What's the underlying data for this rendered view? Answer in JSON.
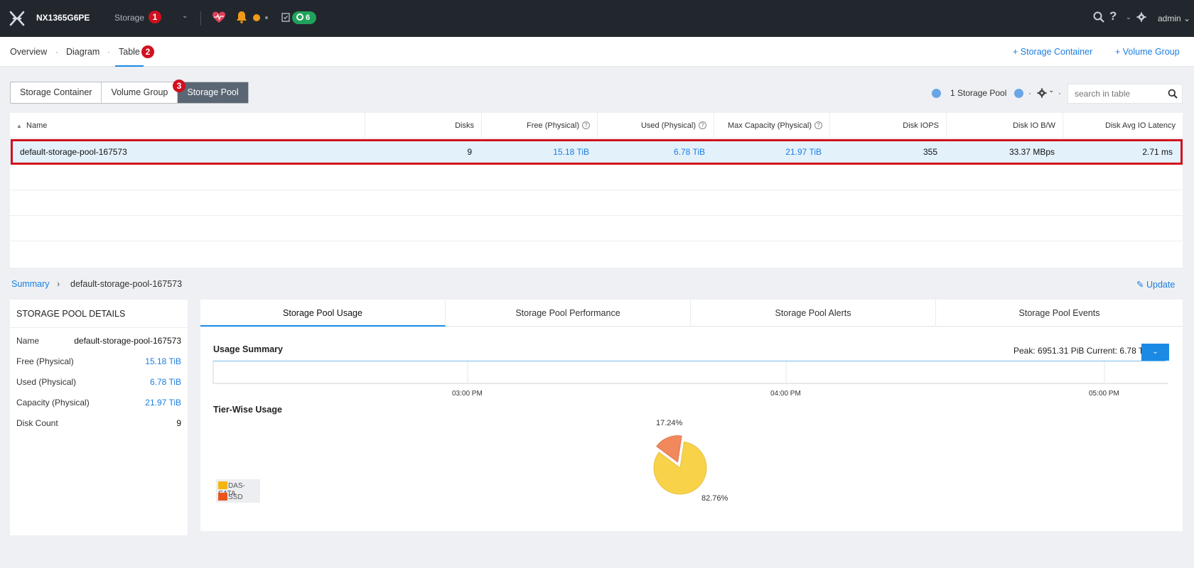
{
  "topbar": {
    "cluster_name": "NX1365G6PE",
    "nav_label": "Storage",
    "nav_badge": "1",
    "tasks_count": "6",
    "user": "admin"
  },
  "subnav": {
    "tabs": [
      "Overview",
      "Diagram",
      "Table"
    ],
    "separator": "·",
    "table_badge": "2",
    "actions": [
      "+ Storage Container",
      "+ Volume Group"
    ]
  },
  "segments": {
    "items": [
      "Storage Container",
      "Volume Group",
      "Storage Pool"
    ],
    "active": "Storage Pool",
    "badge": "3"
  },
  "pager": {
    "label": "1 Storage Pool",
    "dots": "·"
  },
  "search": {
    "placeholder": "search in table"
  },
  "table": {
    "columns": [
      "Name",
      "Disks",
      "Free (Physical)",
      "Used (Physical)",
      "Max Capacity (Physical)",
      "Disk IOPS",
      "Disk IO B/W",
      "Disk Avg IO Latency"
    ],
    "rows": [
      [
        "default-storage-pool-167573",
        "9",
        "15.18 TiB",
        "6.78 TiB",
        "21.97 TiB",
        "355",
        "33.37 MBps",
        "2.71 ms"
      ]
    ]
  },
  "breadcrumb": {
    "root": "Summary",
    "sep": "›",
    "current": "default-storage-pool-167573",
    "update": "Update"
  },
  "details": {
    "title": "STORAGE POOL DETAILS",
    "rows": [
      {
        "k": "Name",
        "v": "default-storage-pool-167573"
      },
      {
        "k": "Free (Physical)",
        "v": "15.18 TiB"
      },
      {
        "k": "Used (Physical)",
        "v": "6.78 TiB"
      },
      {
        "k": "Capacity (Physical)",
        "v": "21.97 TiB"
      },
      {
        "k": "Disk Count",
        "v": "9"
      }
    ]
  },
  "panel": {
    "tabs": [
      "Storage Pool Usage",
      "Storage Pool Performance",
      "Storage Pool Alerts",
      "Storage Pool Events"
    ],
    "usage_title": "Usage Summary",
    "peak_text": "Peak: 6951.31 PiB  Current: 6.78 T",
    "ticks": [
      "03:00 PM",
      "04:00 PM",
      "05:00 PM"
    ],
    "tier_title": "Tier-Wise Usage"
  },
  "chart_data": {
    "type": "pie",
    "title": "Tier-Wise Usage",
    "slices": [
      {
        "name": "DAS-SATA",
        "value": 82.76,
        "label": "82.76%",
        "color": "#f8d34a"
      },
      {
        "name": "SSD",
        "value": 17.24,
        "label": "17.24%",
        "color": "#f2895d"
      }
    ],
    "legend": "bottom-left"
  },
  "colors": {
    "accent": "#1b8ae4",
    "topbar": "#22272e",
    "badge_red": "#d1101e",
    "link_blue": "#1b7ee0"
  }
}
